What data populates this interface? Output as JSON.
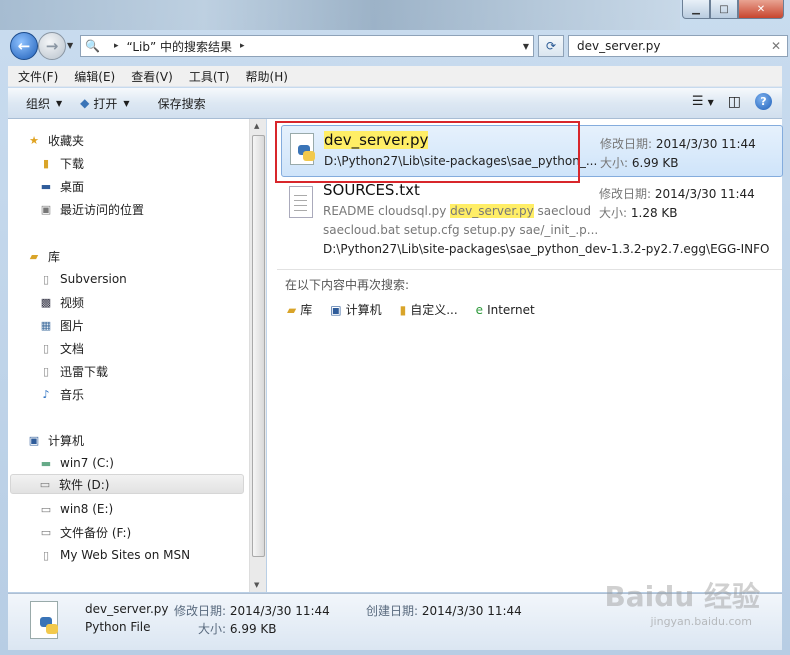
{
  "address": {
    "path": "“Lib” 中的搜索结果",
    "search_value": "dev_server.py"
  },
  "menu": [
    "文件(F)",
    "编辑(E)",
    "查看(V)",
    "工具(T)",
    "帮助(H)"
  ],
  "toolbar": {
    "organize": "组织",
    "open": "打开",
    "save_search": "保存搜索"
  },
  "nav": {
    "favorites": "收藏夹",
    "fav_items": [
      "下载",
      "桌面",
      "最近访问的位置"
    ],
    "libraries": "库",
    "lib_items": [
      "Subversion",
      "视频",
      "图片",
      "文档",
      "迅雷下载",
      "音乐"
    ],
    "computer": "计算机",
    "drives": [
      "win7 (C:)",
      "软件 (D:)",
      "win8 (E:)",
      "文件备份 (F:)",
      "My Web Sites on MSN"
    ]
  },
  "results": [
    {
      "name_highlight": "dev_server.py",
      "path": "D:\\Python27\\Lib\\site-packages\\sae_python_...",
      "modified_label": "修改日期:",
      "modified": "2014/3/30 11:44",
      "size_label": "大小:",
      "size": "6.99 KB"
    },
    {
      "name": "SOURCES.txt",
      "snippet_pre": "README cloudsql.py ",
      "snippet_hl": "dev_server.py",
      "snippet_post": " saecloud",
      "snippet2": "saecloud.bat setup.cfg setup.py sae/_init_.p...",
      "path": "D:\\Python27\\Lib\\site-packages\\sae_python_dev-1.3.2-py2.7.egg\\EGG-INFO",
      "modified_label": "修改日期:",
      "modified": "2014/3/30 11:44",
      "size_label": "大小:",
      "size": "1.28 KB"
    }
  ],
  "search_again": {
    "label": "在以下内容中再次搜索:",
    "locations": [
      "库",
      "计算机",
      "自定义...",
      "Internet"
    ]
  },
  "details": {
    "name": "dev_server.py",
    "type": "Python File",
    "modified_label": "修改日期:",
    "modified": "2014/3/30 11:44",
    "created_label": "创建日期:",
    "created": "2014/3/30 11:44",
    "size_label": "大小:",
    "size": "6.99 KB"
  },
  "watermark": {
    "main": "Baidu 经验",
    "sub": "jingyan.baidu.com"
  }
}
